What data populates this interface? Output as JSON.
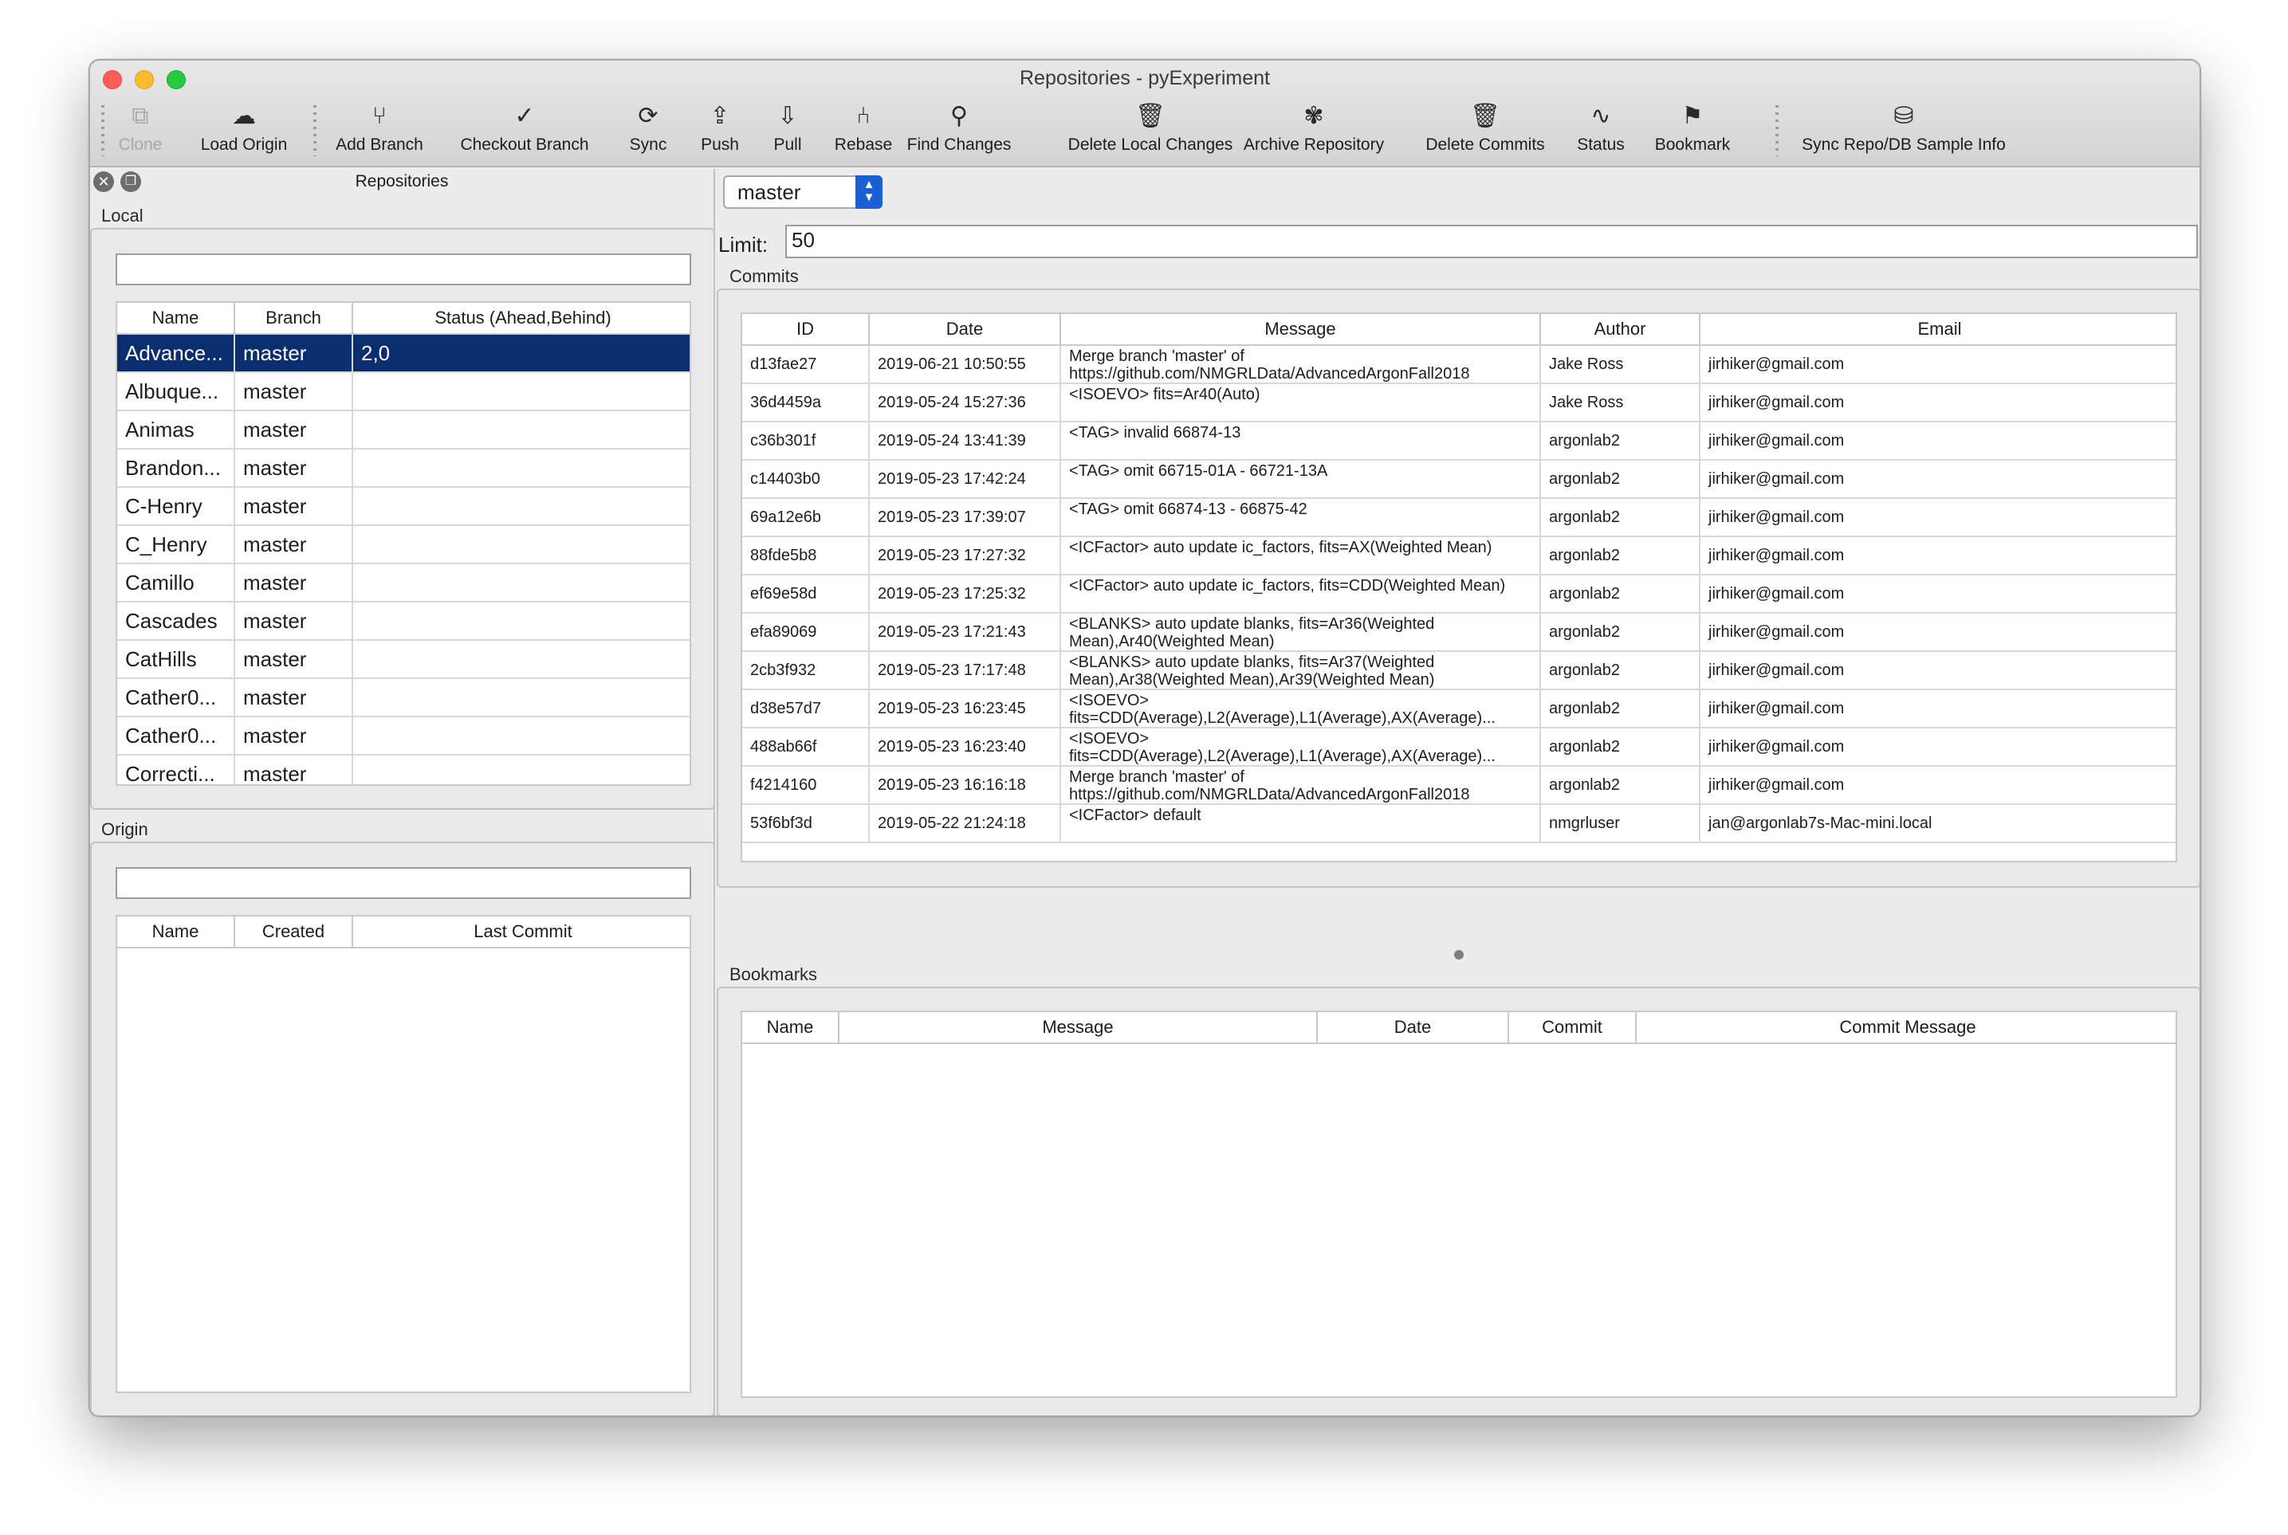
{
  "window": {
    "title": "Repositories - pyExperiment"
  },
  "toolbar": {
    "buttons": [
      {
        "label": "Clone",
        "icon": "clone-icon",
        "glyph": "⧉",
        "disabled": true
      },
      {
        "label": "Load Origin",
        "icon": "cloud-download-icon",
        "glyph": "☁"
      },
      {
        "label": "Add Branch",
        "icon": "branch-icon",
        "glyph": "⑂"
      },
      {
        "label": "Checkout Branch",
        "icon": "checkmark-icon",
        "glyph": "✓"
      },
      {
        "label": "Sync",
        "icon": "refresh-icon",
        "glyph": "⟳"
      },
      {
        "label": "Push",
        "icon": "push-icon",
        "glyph": "⇪"
      },
      {
        "label": "Pull",
        "icon": "pull-icon",
        "glyph": "⇩"
      },
      {
        "label": "Rebase",
        "icon": "rebase-icon",
        "glyph": "⑃"
      },
      {
        "label": "Find Changes",
        "icon": "search-icon",
        "glyph": "⚲"
      },
      {
        "label": "Delete Local Changes",
        "icon": "trash-icon",
        "glyph": "🗑"
      },
      {
        "label": "Archive Repository",
        "icon": "squirrel-icon",
        "glyph": "✾"
      },
      {
        "label": "Delete Commits",
        "icon": "trash-icon",
        "glyph": "🗑"
      },
      {
        "label": "Status",
        "icon": "pulse-icon",
        "glyph": "∿"
      },
      {
        "label": "Bookmark",
        "icon": "bookmark-icon",
        "glyph": "⚑"
      },
      {
        "label": "Sync Repo/DB Sample Info",
        "icon": "database-icon",
        "glyph": "⛁"
      }
    ]
  },
  "left": {
    "dock_title": "Repositories",
    "close_glyph": "✕",
    "float_glyph": "❐",
    "local": {
      "title": "Local",
      "filter_value": "",
      "columns": [
        "Name",
        "Branch",
        "Status (Ahead,Behind)"
      ],
      "rows": [
        {
          "name": "Advance...",
          "branch": "master",
          "status": "2,0",
          "selected": true
        },
        {
          "name": "Albuque...",
          "branch": "master",
          "status": ""
        },
        {
          "name": "Animas",
          "branch": "master",
          "status": ""
        },
        {
          "name": "Brandon...",
          "branch": "master",
          "status": ""
        },
        {
          "name": "C-Henry",
          "branch": "master",
          "status": ""
        },
        {
          "name": "C_Henry",
          "branch": "master",
          "status": ""
        },
        {
          "name": "Camillo",
          "branch": "master",
          "status": ""
        },
        {
          "name": "Cascades",
          "branch": "master",
          "status": ""
        },
        {
          "name": "CatHills",
          "branch": "master",
          "status": ""
        },
        {
          "name": "Cather0...",
          "branch": "master",
          "status": ""
        },
        {
          "name": "Cather0...",
          "branch": "master",
          "status": ""
        },
        {
          "name": "Correcti...",
          "branch": "master",
          "status": ""
        }
      ]
    },
    "origin": {
      "title": "Origin",
      "filter_value": "",
      "columns": [
        "Name",
        "Created",
        "Last Commit"
      ]
    }
  },
  "right": {
    "branch": "master",
    "limit_label": "Limit:",
    "limit_value": "50",
    "commits": {
      "title": "Commits",
      "columns": [
        "ID",
        "Date",
        "Message",
        "Author",
        "Email"
      ],
      "rows": [
        {
          "id": "d13fae27",
          "date": "2019-06-21 10:50:55",
          "message": "Merge branch 'master' of https://github.com/NMGRLData/AdvancedArgonFall2018",
          "author": "Jake Ross",
          "email": "jirhiker@gmail.com"
        },
        {
          "id": "36d4459a",
          "date": "2019-05-24 15:27:36",
          "message": "<ISOEVO> fits=Ar40(Auto)",
          "author": "Jake Ross",
          "email": "jirhiker@gmail.com"
        },
        {
          "id": "c36b301f",
          "date": "2019-05-24 13:41:39",
          "message": "<TAG> invalid 66874-13",
          "author": "argonlab2",
          "email": "jirhiker@gmail.com"
        },
        {
          "id": "c14403b0",
          "date": "2019-05-23 17:42:24",
          "message": "<TAG> omit   66715-01A - 66721-13A",
          "author": "argonlab2",
          "email": "jirhiker@gmail.com"
        },
        {
          "id": "69a12e6b",
          "date": "2019-05-23 17:39:07",
          "message": "<TAG> omit   66874-13 - 66875-42",
          "author": "argonlab2",
          "email": "jirhiker@gmail.com"
        },
        {
          "id": "88fde5b8",
          "date": "2019-05-23 17:27:32",
          "message": "<ICFactor> auto update ic_factors, fits=AX(Weighted Mean)",
          "author": "argonlab2",
          "email": "jirhiker@gmail.com"
        },
        {
          "id": "ef69e58d",
          "date": "2019-05-23 17:25:32",
          "message": "<ICFactor> auto update ic_factors, fits=CDD(Weighted Mean)",
          "author": "argonlab2",
          "email": "jirhiker@gmail.com"
        },
        {
          "id": "efa89069",
          "date": "2019-05-23 17:21:43",
          "message": "<BLANKS> auto update blanks, fits=Ar36(Weighted Mean),Ar40(Weighted Mean)",
          "author": "argonlab2",
          "email": "jirhiker@gmail.com"
        },
        {
          "id": "2cb3f932",
          "date": "2019-05-23 17:17:48",
          "message": "<BLANKS> auto update blanks, fits=Ar37(Weighted Mean),Ar38(Weighted Mean),Ar39(Weighted Mean)",
          "author": "argonlab2",
          "email": "jirhiker@gmail.com"
        },
        {
          "id": "d38e57d7",
          "date": "2019-05-23 16:23:45",
          "message": "<ISOEVO> fits=CDD(Average),L2(Average),L1(Average),AX(Average)...",
          "author": "argonlab2",
          "email": "jirhiker@gmail.com"
        },
        {
          "id": "488ab66f",
          "date": "2019-05-23 16:23:40",
          "message": "<ISOEVO> fits=CDD(Average),L2(Average),L1(Average),AX(Average)...",
          "author": "argonlab2",
          "email": "jirhiker@gmail.com"
        },
        {
          "id": "f4214160",
          "date": "2019-05-23 16:16:18",
          "message": "Merge branch 'master' of https://github.com/NMGRLData/AdvancedArgonFall2018",
          "author": "argonlab2",
          "email": "jirhiker@gmail.com"
        },
        {
          "id": "53f6bf3d",
          "date": "2019-05-22 21:24:18",
          "message": "<ICFactor> default",
          "author": "nmgrluser",
          "email": "jan@argonlab7s-Mac-mini.local"
        }
      ]
    },
    "bookmarks": {
      "title": "Bookmarks",
      "columns": [
        "Name",
        "Message",
        "Date",
        "Commit",
        "Commit Message"
      ]
    }
  }
}
